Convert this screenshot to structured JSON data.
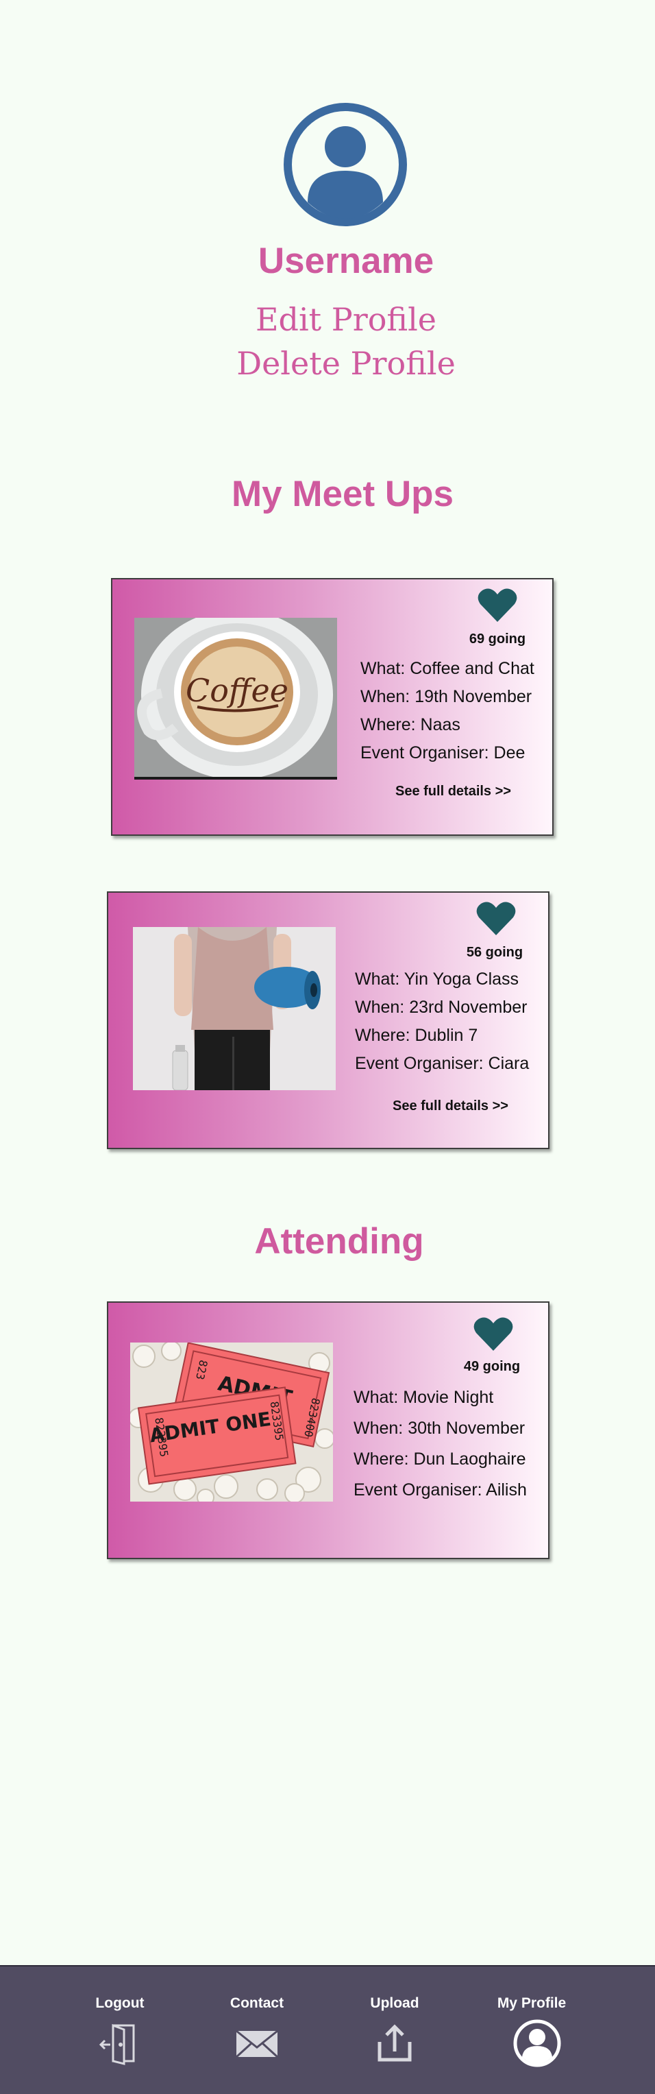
{
  "profile": {
    "username": "Username",
    "edit_label": "Edit Profile",
    "delete_label": "Delete Profile"
  },
  "sections": {
    "meetups_title": "My Meet Ups",
    "attending_title": "Attending"
  },
  "meetups": [
    {
      "going": "69 going",
      "what": "What: Coffee and Chat",
      "when": "When: 19th November",
      "where": "Where: Naas",
      "organiser": "Event Organiser: Dee",
      "details": "See full details >>",
      "image": "coffee-photo"
    },
    {
      "going": "56 going",
      "what": "What: Yin Yoga Class",
      "when": "When: 23rd November",
      "where": "Where: Dublin 7",
      "organiser": "Event Organiser: Ciara",
      "details": "See full details >>",
      "image": "yoga-photo"
    }
  ],
  "attending": [
    {
      "going": "49 going",
      "what": "What: Movie Night",
      "when": "When: 30th November",
      "where": "Where: Dun Laoghaire",
      "organiser": "Event Organiser: Ailish",
      "image": "movie-tickets-photo",
      "ticket_text": "ADMIT ONE",
      "ticket_text_back": "ADMIT",
      "ticket_number": "823395",
      "ticket_number_back": "823400",
      "ticket_number_back_partial": "823"
    }
  ],
  "nav": {
    "logout": "Logout",
    "contact": "Contact",
    "upload": "Upload",
    "my_profile": "My Profile"
  },
  "colors": {
    "accent": "#cf5a9e",
    "avatar": "#3b6aa0",
    "heart": "#1f5b62",
    "navbar": "#514c62",
    "background": "#f6fdf5"
  }
}
